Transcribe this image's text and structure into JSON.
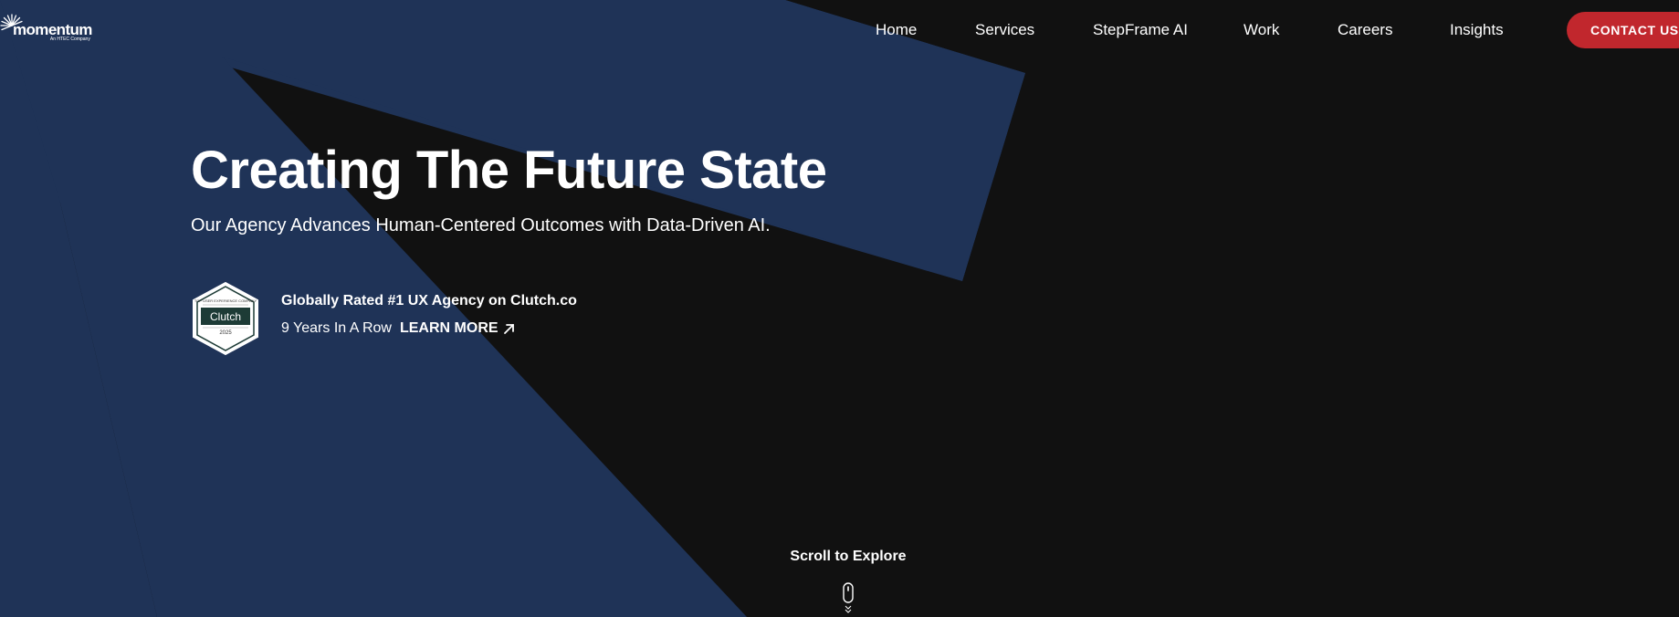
{
  "brand": {
    "name": "momentum",
    "tagline": "An HTEC Company"
  },
  "nav": {
    "items": [
      {
        "label": "Home"
      },
      {
        "label": "Services"
      },
      {
        "label": "StepFrame AI"
      },
      {
        "label": "Work"
      },
      {
        "label": "Careers"
      },
      {
        "label": "Insights"
      }
    ],
    "cta_label": "CONTACT US"
  },
  "hero": {
    "title": "Creating The Future State",
    "subtitle": "Our Agency Advances Human-Centered Outcomes with Data-Driven AI."
  },
  "badge": {
    "top_text": "TOP USER EXPERIENCE COMPANY",
    "brand": "Clutch",
    "year": "2025",
    "title": "Globally Rated #1 UX Agency on Clutch.co",
    "years_text": "9 Years In A Row",
    "link_label": "LEARN MORE"
  },
  "scroll": {
    "label": "Scroll to Explore"
  },
  "icons": [
    "sunburst-logo-icon",
    "clutch-badge-icon",
    "arrow-up-right-icon",
    "mouse-scroll-icon"
  ],
  "colors": {
    "background": "#111111",
    "shape_navy": "#1f3357",
    "cta_red": "#c1272d",
    "text": "#ffffff"
  }
}
